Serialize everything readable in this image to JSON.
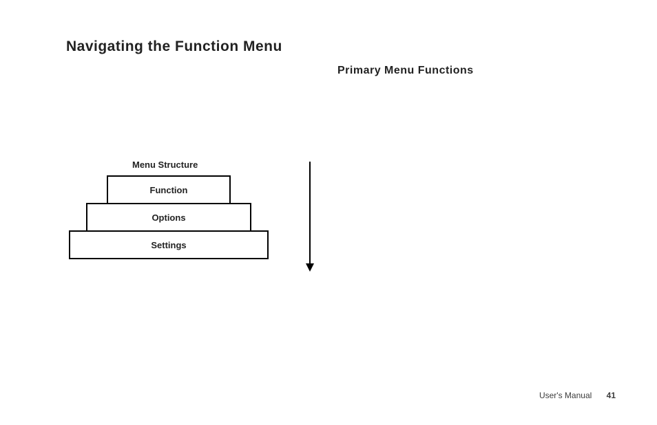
{
  "heading": "Navigating the Function Menu",
  "subheading": "Primary Menu Functions",
  "diagram": {
    "label": "Menu Structure",
    "tiers": {
      "t1": "Function",
      "t2": "Options",
      "t3": "Settings"
    }
  },
  "footer": {
    "label": "User's Manual",
    "page": "41"
  }
}
